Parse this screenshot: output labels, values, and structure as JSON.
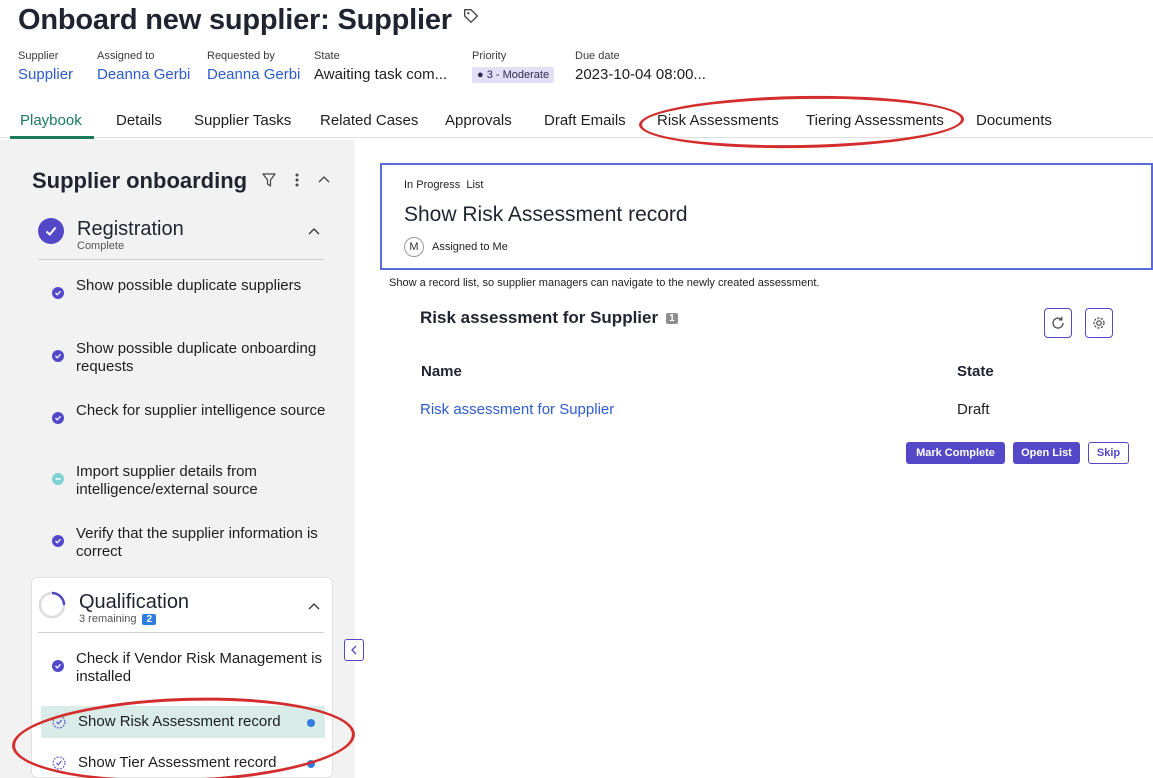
{
  "header": {
    "title": "Onboard new supplier: Supplier",
    "meta": [
      {
        "label": "Supplier",
        "value": "Supplier"
      },
      {
        "label": "Assigned to",
        "value": "Deanna Gerbi"
      },
      {
        "label": "Requested by",
        "value": "Deanna Gerbi"
      },
      {
        "label": "State",
        "value": "Awaiting task com..."
      },
      {
        "label": "Priority",
        "value": "● 3 - Moderate"
      },
      {
        "label": "Due date",
        "value": "2023-10-04 08:00..."
      }
    ]
  },
  "tabs": [
    {
      "label": "Playbook",
      "active": true
    },
    {
      "label": "Details"
    },
    {
      "label": "Supplier Tasks"
    },
    {
      "label": "Related Cases"
    },
    {
      "label": "Approvals"
    },
    {
      "label": "Draft Emails"
    },
    {
      "label": "Risk Assessments"
    },
    {
      "label": "Tiering Assessments"
    },
    {
      "label": "Documents"
    }
  ],
  "playbook": {
    "title": "Supplier onboarding",
    "stages": [
      {
        "name": "Registration",
        "status": "Complete",
        "tasks": [
          "Show possible duplicate suppliers",
          "Show possible duplicate onboarding requests",
          "Check for supplier intelligence source",
          "Import supplier details from intelligence/external source",
          "Verify that the supplier information is correct"
        ]
      },
      {
        "name": "Qualification",
        "status": "3 remaining",
        "badge": "2",
        "tasks": [
          "Check if Vendor Risk Management is installed",
          "Show Risk Assessment record",
          "Show Tier Assessment record"
        ]
      }
    ]
  },
  "activity": {
    "status": "In Progress",
    "type": "List",
    "title": "Show Risk Assessment record",
    "avatar_initial": "M",
    "assignment": "Assigned to Me",
    "description": "Show a record list, so supplier managers can navigate to the newly created assessment."
  },
  "record_list": {
    "title": "Risk assessment for Supplier",
    "count": "1",
    "columns": [
      "Name",
      "State"
    ],
    "rows": [
      {
        "name": "Risk assessment for Supplier",
        "state": "Draft"
      }
    ]
  },
  "actions": {
    "mark_complete": "Mark Complete",
    "open_list": "Open List",
    "skip": "Skip"
  },
  "colors": {
    "accent": "#5448c8",
    "link": "#2d5bd0",
    "active_tab": "#1b7a5a",
    "annotation": "#d42d2d"
  }
}
